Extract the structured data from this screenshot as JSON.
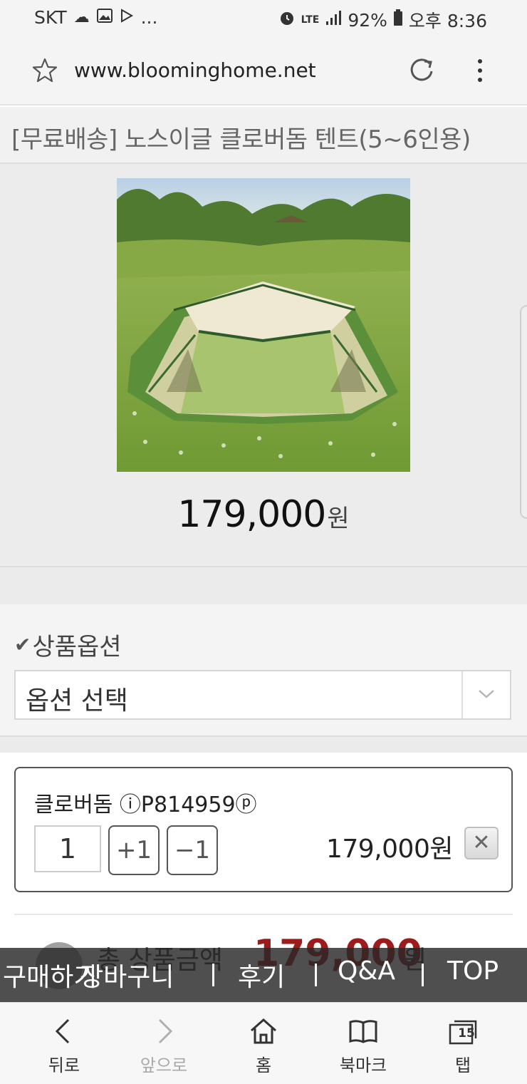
{
  "status_bar": {
    "carrier": "SKT",
    "icons_left": [
      "cloud-icon",
      "image-icon",
      "play-store-icon"
    ],
    "ellipsis": "...",
    "network": "LTE",
    "battery": "92%",
    "time": "오후 8:36"
  },
  "browser": {
    "url": "www.bloominghome.net"
  },
  "product": {
    "title": "[무료배송] 노스이글 클로버돔 텐트(5~6인용)",
    "price_number": "179,000",
    "price_unit": "원"
  },
  "options": {
    "title": "상품옵션",
    "select_value": "옵션 선택"
  },
  "selected_item": {
    "name": "클로버돔 ⓘP814959ⓟ",
    "quantity": "1",
    "plus_label": "+1",
    "minus_label": "−1",
    "price": "179,000원",
    "remove_label": "✕"
  },
  "total": {
    "label": "총 상품금액",
    "amount": "179,000",
    "unit": "원"
  },
  "float_nav": {
    "items": [
      "구매하기",
      "장바구니",
      "후기",
      "Q&A",
      "TOP"
    ]
  },
  "toolbar": {
    "back": "뒤로",
    "forward": "앞으로",
    "home": "홈",
    "bookmarks": "북마크",
    "tabs": "탭",
    "tab_count": "15"
  },
  "colors": {
    "total_amount": "#9e1b1b",
    "float_nav_bg": "#282828",
    "page_bg": "#ececec"
  }
}
